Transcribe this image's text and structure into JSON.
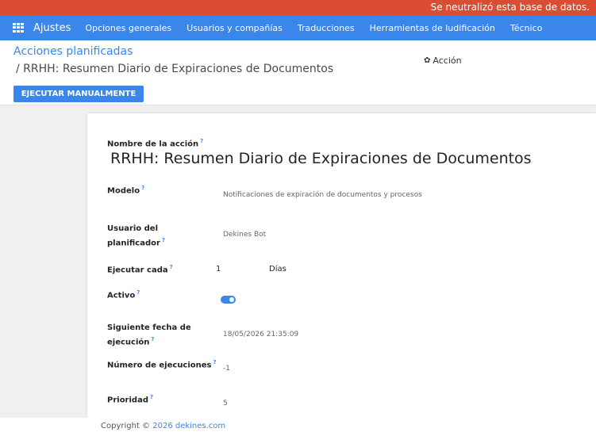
{
  "banner": {
    "text": "Se neutralizó esta base de datos."
  },
  "navbar": {
    "brand": "Ajustes",
    "menu": [
      "Opciones generales",
      "Usuarios y compañías",
      "Traducciones",
      "Herramientas de ludificación",
      "Técnico"
    ]
  },
  "breadcrumb": {
    "root": "Acciones planificadas",
    "current": "/ RRHH: Resumen Diario de Expiraciones de Documentos"
  },
  "action_menu": {
    "label": "Acción"
  },
  "toolbar": {
    "run_label": "EJECUTAR MANUALMENTE"
  },
  "form": {
    "name_label": "Nombre de la acción",
    "name_value": "RRHH: Resumen Diario de Expiraciones de Documentos",
    "model_label": "Modelo",
    "model_value": "Notificaciones de expiración de documentos y procesos",
    "user_label_line1": "Usuario del",
    "user_label_line2": "planificador",
    "user_value": "Dekines Bot",
    "interval_label": "Ejecutar cada",
    "interval_number": "1",
    "interval_unit": "Días",
    "active_label": "Activo",
    "active_value": true,
    "nextcall_label_line1": "Siguiente fecha de",
    "nextcall_label_line2": "ejecución",
    "nextcall_value": "18/05/2026 21:35:09",
    "numcall_label": "Número de ejecuciones",
    "numcall_value": "-1",
    "priority_label": "Prioridad",
    "priority_value": "5",
    "help_mark": "?"
  },
  "footer": {
    "prefix": "Copyright © ",
    "link": "2026 dekines.com"
  },
  "colors": {
    "banner": "#dc4c34",
    "primary": "#3a86ea"
  },
  "icons": {
    "apps": "apps-grid-icon",
    "action": "gear-icon"
  }
}
